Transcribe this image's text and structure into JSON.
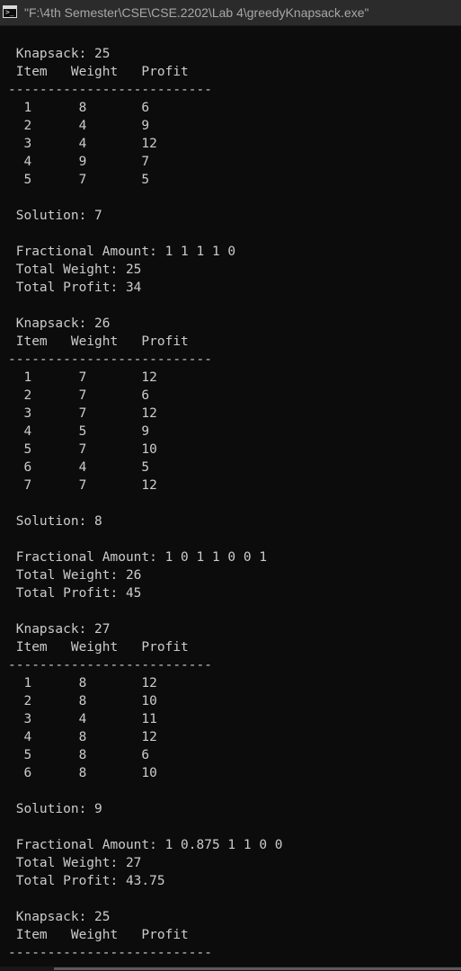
{
  "window": {
    "title": "\"F:\\4th Semester\\CSE\\CSE.2202\\Lab 4\\greedyKnapsack.exe\"",
    "icon": "console-app-icon",
    "icon_glyph": ">_"
  },
  "console": {
    "lines": [
      " Knapsack: 25",
      " Item   Weight   Profit",
      "--------------------------",
      "  1      8       6",
      "  2      4       9",
      "  3      4       12",
      "  4      9       7",
      "  5      7       5",
      "",
      " Solution: 7",
      "",
      " Fractional Amount: 1 1 1 1 0",
      " Total Weight: 25",
      " Total Profit: 34",
      "",
      " Knapsack: 26",
      " Item   Weight   Profit",
      "--------------------------",
      "  1      7       12",
      "  2      7       6",
      "  3      7       12",
      "  4      5       9",
      "  5      7       10",
      "  6      4       5",
      "  7      7       12",
      "",
      " Solution: 8",
      "",
      " Fractional Amount: 1 0 1 1 0 0 1",
      " Total Weight: 26",
      " Total Profit: 45",
      "",
      " Knapsack: 27",
      " Item   Weight   Profit",
      "--------------------------",
      "  1      8       12",
      "  2      8       10",
      "  3      4       11",
      "  4      8       12",
      "  5      8       6",
      "  6      8       10",
      "",
      " Solution: 9",
      "",
      " Fractional Amount: 1 0.875 1 1 0 0",
      " Total Weight: 27",
      " Total Profit: 43.75",
      "",
      " Knapsack: 25",
      " Item   Weight   Profit",
      "--------------------------"
    ]
  },
  "colors": {
    "background": "#0c0c0c",
    "text": "#cccccc",
    "titlebar": "#2b2b2b",
    "title_text": "#a7a7a7"
  }
}
